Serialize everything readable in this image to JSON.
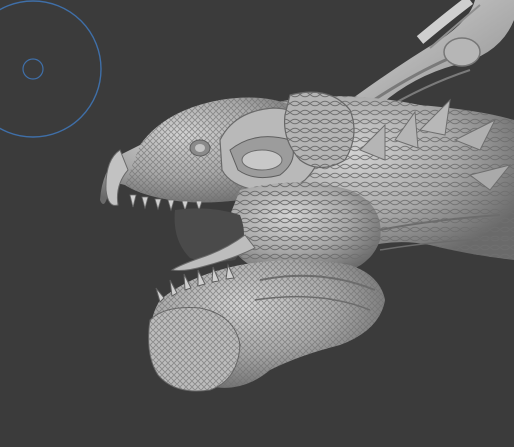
{
  "app": {
    "mode": "sculpt",
    "viewport_background": "#3b3b3b"
  },
  "brush_cursor": {
    "color": "#3f6fa8",
    "outer_circle": "brush-radius",
    "inner_circle": "brush-center"
  },
  "model": {
    "object": "dragon-head",
    "material_color": "#a8a8a8",
    "shadow_color": "#5a5a5a",
    "highlight_color": "#cfcfcf"
  }
}
